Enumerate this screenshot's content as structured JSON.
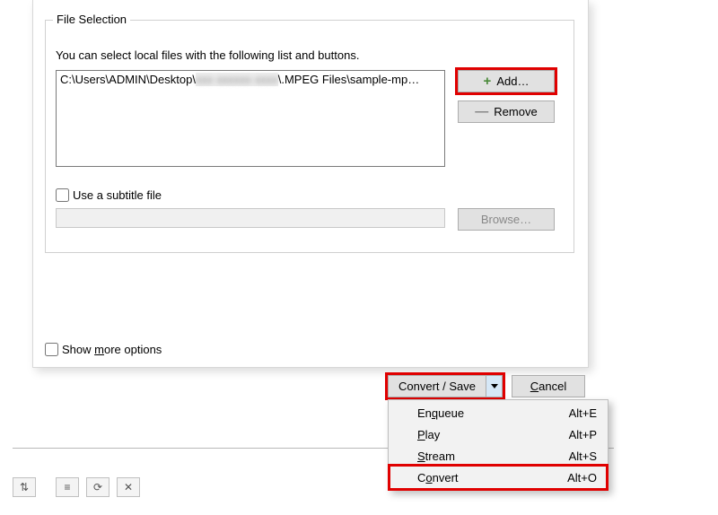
{
  "group": {
    "title": "File Selection",
    "hint": "You can select local files with the following list and buttons."
  },
  "file_list": {
    "prefix": "C:\\Users\\ADMIN\\Desktop\\",
    "blurred": "xxx xxxxxx xxxx",
    "suffix": "\\.MPEG Files\\sample-mp…"
  },
  "buttons": {
    "add": "Add…",
    "remove": "Remove",
    "browse": "Browse…",
    "convert_save": "Convert / Save",
    "cancel": "Cancel"
  },
  "subtitle": {
    "label": "Use a subtitle file"
  },
  "more_options": "Show more options",
  "menu": {
    "items": [
      {
        "label_pre": "En",
        "label_u": "q",
        "label_post": "ueue",
        "shortcut": "Alt+E"
      },
      {
        "label_pre": "",
        "label_u": "P",
        "label_post": "lay",
        "shortcut": "Alt+P"
      },
      {
        "label_pre": "",
        "label_u": "S",
        "label_post": "tream",
        "shortcut": "Alt+S"
      },
      {
        "label_pre": "C",
        "label_u": "o",
        "label_post": "nvert",
        "shortcut": "Alt+O"
      }
    ]
  },
  "cancel_u": "C",
  "cancel_post": "ancel",
  "more_u": "m",
  "more_pre": "Show ",
  "more_post": "ore options"
}
